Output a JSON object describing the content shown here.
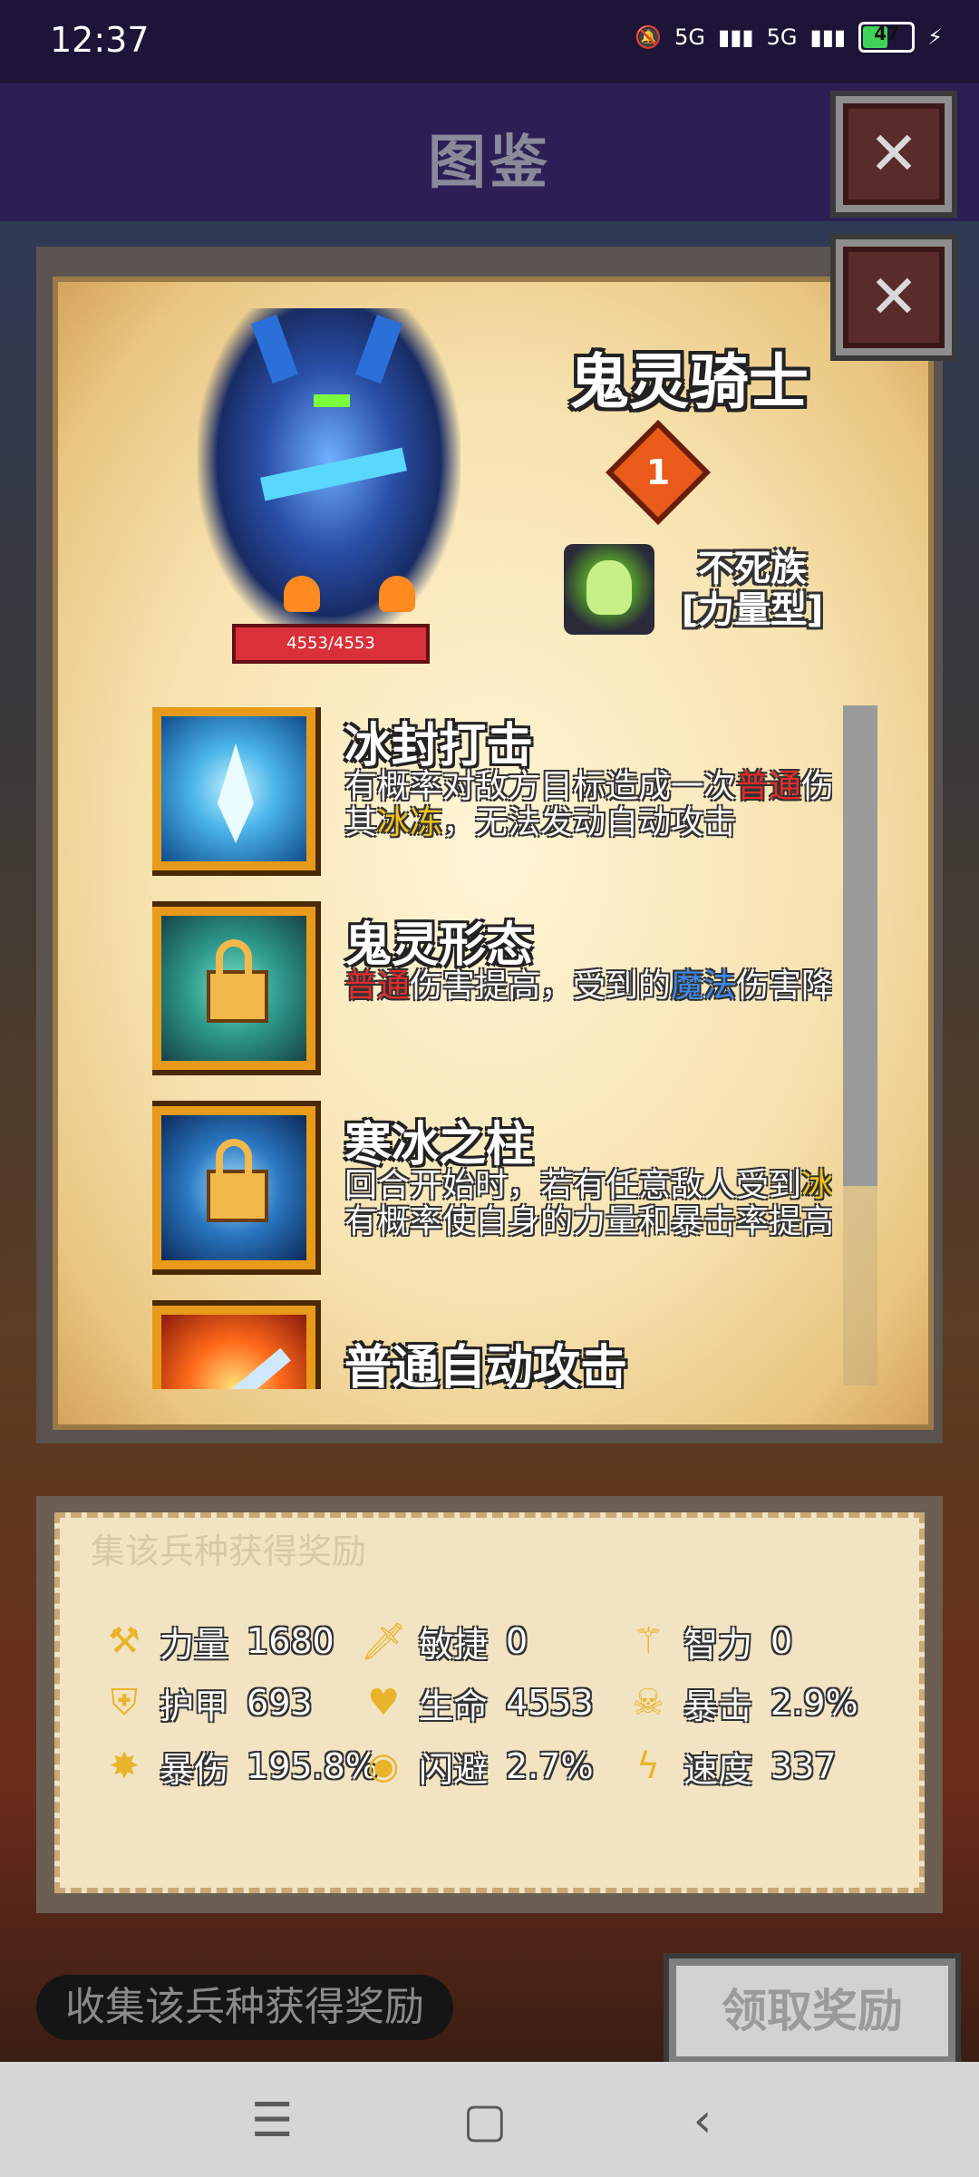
{
  "status_bar": {
    "time": "12:37",
    "network1": "5G",
    "network2": "5G",
    "battery": "47"
  },
  "header": {
    "title": "图鉴",
    "close_label": "✕"
  },
  "detail": {
    "close_label": "✕",
    "unit_name": "鬼灵骑士",
    "rank": "1",
    "hp": "4553/4553",
    "race_line1": "不死族",
    "race_line2": "[力量型]"
  },
  "skills": [
    {
      "name": "冰封打击",
      "desc_parts": [
        "有概率对敌方目标造成一次",
        "普通",
        "伤害，并使其",
        "冰冻",
        "，无法发动自动攻击"
      ]
    },
    {
      "name": "鬼灵形态",
      "desc_parts": [
        "普通",
        "伤害提高，受到的",
        "魔法",
        "伤害降低"
      ]
    },
    {
      "name": "寒冰之柱",
      "desc_parts": [
        "回合开始时，若有任意敌人受到",
        "冰冻",
        "影响，有概率使自身的力量和暴击率提高"
      ]
    },
    {
      "name": "普通自动攻击"
    }
  ],
  "stats_faint_label": "集该兵种获得奖励",
  "stats": [
    {
      "icon": "axe-icon",
      "label": "力量",
      "value": "1680"
    },
    {
      "icon": "dagger-icon",
      "label": "敏捷",
      "value": "0"
    },
    {
      "icon": "staff-icon",
      "label": "智力",
      "value": "0"
    },
    {
      "icon": "shield-icon",
      "label": "护甲",
      "value": "693"
    },
    {
      "icon": "heart-icon",
      "label": "生命",
      "value": "4553"
    },
    {
      "icon": "skull-icon",
      "label": "暴击",
      "value": "2.9%"
    },
    {
      "icon": "burst-icon",
      "label": "暴伤",
      "value": "195.8%"
    },
    {
      "icon": "eye-icon",
      "label": "闪避",
      "value": "2.7%"
    },
    {
      "icon": "lightning-icon",
      "label": "速度",
      "value": "337"
    }
  ],
  "bottom": {
    "collect_label": "收集该兵种获得奖励",
    "claim_button": "领取奖励"
  },
  "colors": {
    "accent_red": "#e82a2a",
    "accent_yellow": "#f2c21a",
    "accent_blue": "#3a8af0",
    "frame_gold": "#e89a1a"
  }
}
